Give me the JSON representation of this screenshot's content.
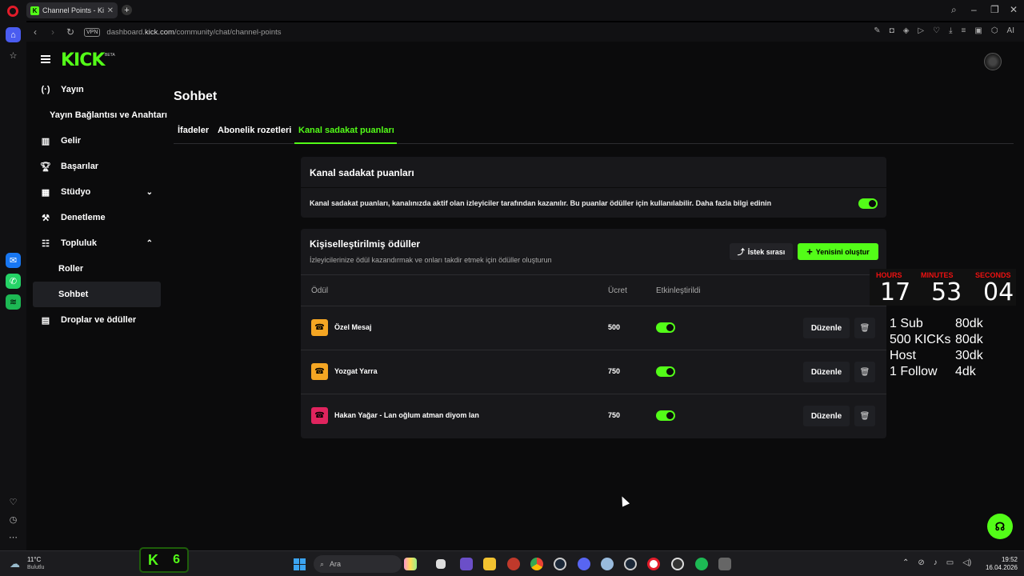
{
  "browser": {
    "tab_title": "Channel Points - Kick Das",
    "tab_favicon": "K",
    "url_prefix": "dashboard.",
    "url_domain": "kick.com",
    "url_path": "/community/chat/channel-points",
    "vpn_label": "VPN",
    "ai_label": "AI"
  },
  "kick": {
    "logo": "KICK",
    "beta": "BETA"
  },
  "sidebar": {
    "items": [
      {
        "label": "Yayın",
        "icon": "broadcast-icon"
      },
      {
        "label": "Yayın Bağlantısı ve Anahtarı",
        "icon": ""
      },
      {
        "label": "Gelir",
        "icon": "revenue-icon"
      },
      {
        "label": "Başarılar",
        "icon": "trophy-icon"
      },
      {
        "label": "Stüdyo",
        "icon": "studio-icon"
      },
      {
        "label": "Denetleme",
        "icon": "wrench-icon"
      },
      {
        "label": "Topluluk",
        "icon": "community-icon"
      },
      {
        "label": "Roller",
        "icon": ""
      },
      {
        "label": "Sohbet",
        "icon": ""
      },
      {
        "label": "Droplar ve ödüller",
        "icon": "gift-icon"
      }
    ]
  },
  "page": {
    "title": "Sohbet",
    "tabs": [
      "İfadeler",
      "Abonelik rozetleri",
      "Kanal sadakat puanları"
    ],
    "active_tab": "Kanal sadakat puanları"
  },
  "loyalty": {
    "title": "Kanal sadakat puanları",
    "description": "Kanal sadakat puanları, kanalınızda aktif olan izleyiciler tarafından kazanılır. Bu puanlar ödüller için kullanılabilir. Daha fazla bilgi edinin",
    "enabled": true
  },
  "rewards": {
    "title": "Kişiselleştirilmiş ödüller",
    "subtitle": "İzleyicilerinize ödül kazandırmak ve onları takdir etmek için ödüller oluşturun",
    "queue_label": "İstek sırası",
    "create_label": "Yenisini oluştur",
    "columns": {
      "reward": "Ödül",
      "cost": "Ücret",
      "enabled": "Etkinleştirildi"
    },
    "edit_label": "Düzenle",
    "rows": [
      {
        "name": "Özel Mesaj",
        "cost": "500",
        "enabled": true,
        "color": "#f5a623"
      },
      {
        "name": "Yozgat Yarra",
        "cost": "750",
        "enabled": true,
        "color": "#f5a623"
      },
      {
        "name": "Hakan Yağar - Lan oğlum atman diyom lan",
        "cost": "750",
        "enabled": true,
        "color": "#e0245e"
      }
    ]
  },
  "overlay": {
    "hours_label": "HOURS",
    "minutes_label": "MINUTES",
    "seconds_label": "SECONDS",
    "hours": "17",
    "minutes": "53",
    "seconds": "04",
    "goals": [
      {
        "left": "1 Sub",
        "right": "80dk"
      },
      {
        "left": "500 KICKs",
        "right": "80dk"
      },
      {
        "left": "Host",
        "right": "30dk"
      },
      {
        "left": "1 Follow",
        "right": "4dk"
      }
    ]
  },
  "taskbar": {
    "temperature": "11°C",
    "condition": "Bulutlu",
    "kick_widget_count": "6",
    "search_placeholder": "Ara",
    "time": "19:52",
    "date": "16.04.2026"
  },
  "colors": {
    "accent": "#53fc18",
    "background": "#0b0b0c",
    "card": "#18181b"
  }
}
